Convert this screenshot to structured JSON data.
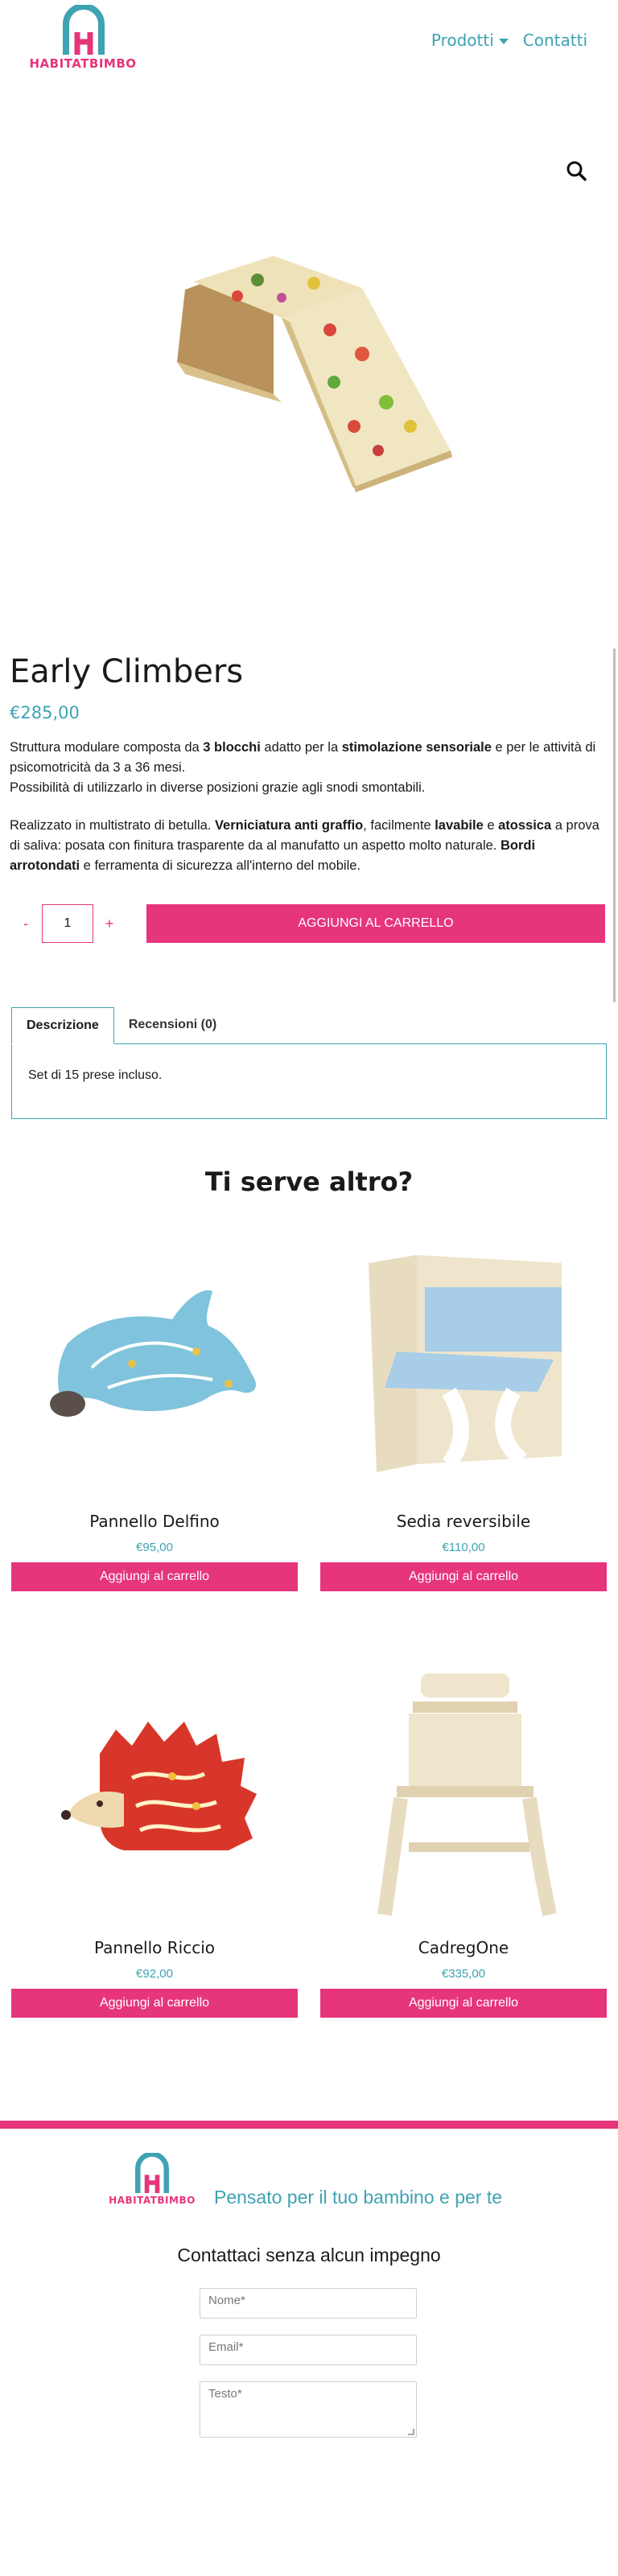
{
  "brand": {
    "name": "HABITATBIMBO",
    "accent": "#e6357b",
    "secondary": "#3ea3b3"
  },
  "nav": {
    "products": "Prodotti",
    "contacts": "Contatti"
  },
  "product": {
    "title": "Early Climbers",
    "price": "€285,00",
    "description": {
      "p1_a": "Struttura modulare composta da ",
      "p1_b": "3 blocchi",
      "p1_c": " adatto per la ",
      "p1_d": "stimolazione sensoriale",
      "p1_e": " e per le attività di psicomotricità da 3 a 36 mesi.",
      "p1_f": "Possibilità di utilizzarlo in diverse posizioni grazie agli snodi smontabili.",
      "p2_a": "Realizzato in multistrato di betulla. ",
      "p2_b": "Verniciatura anti graffio",
      "p2_c": ", facilmente ",
      "p2_d": "lavabile",
      "p2_e": " e ",
      "p2_f": "atossica",
      "p2_g": " a prova di saliva: posata con finitura trasparente da al manufatto un aspetto molto naturale. ",
      "p2_h": "Bordi arrotondati",
      "p2_i": " e ferramenta di sicurezza all'interno del mobile."
    },
    "quantity": {
      "minus": "-",
      "value": "1",
      "plus": "+"
    },
    "add_to_cart": "AGGIUNGI AL CARRELLO"
  },
  "tabs": [
    {
      "label": "Descrizione"
    },
    {
      "label": "Recensioni (0)"
    }
  ],
  "tab_content": "Set di 15 prese incluso.",
  "related": {
    "title": "Ti serve altro?",
    "items": [
      {
        "name": "Pannello Delfino",
        "price": "€95,00",
        "button": "Aggiungi al carrello"
      },
      {
        "name": "Sedia reversibile",
        "price": "€110,00",
        "button": "Aggiungi al carrello"
      },
      {
        "name": "Pannello Riccio",
        "price": "€92,00",
        "button": "Aggiungi al carrello"
      },
      {
        "name": "CadregOne",
        "price": "€335,00",
        "button": "Aggiungi al carrello"
      }
    ]
  },
  "footer": {
    "tagline": "Pensato per il tuo bambino e per te",
    "contact_title": "Contattaci senza alcun impegno",
    "name_placeholder": "Nome*",
    "email_placeholder": "Email*",
    "text_placeholder": "Testo*"
  }
}
